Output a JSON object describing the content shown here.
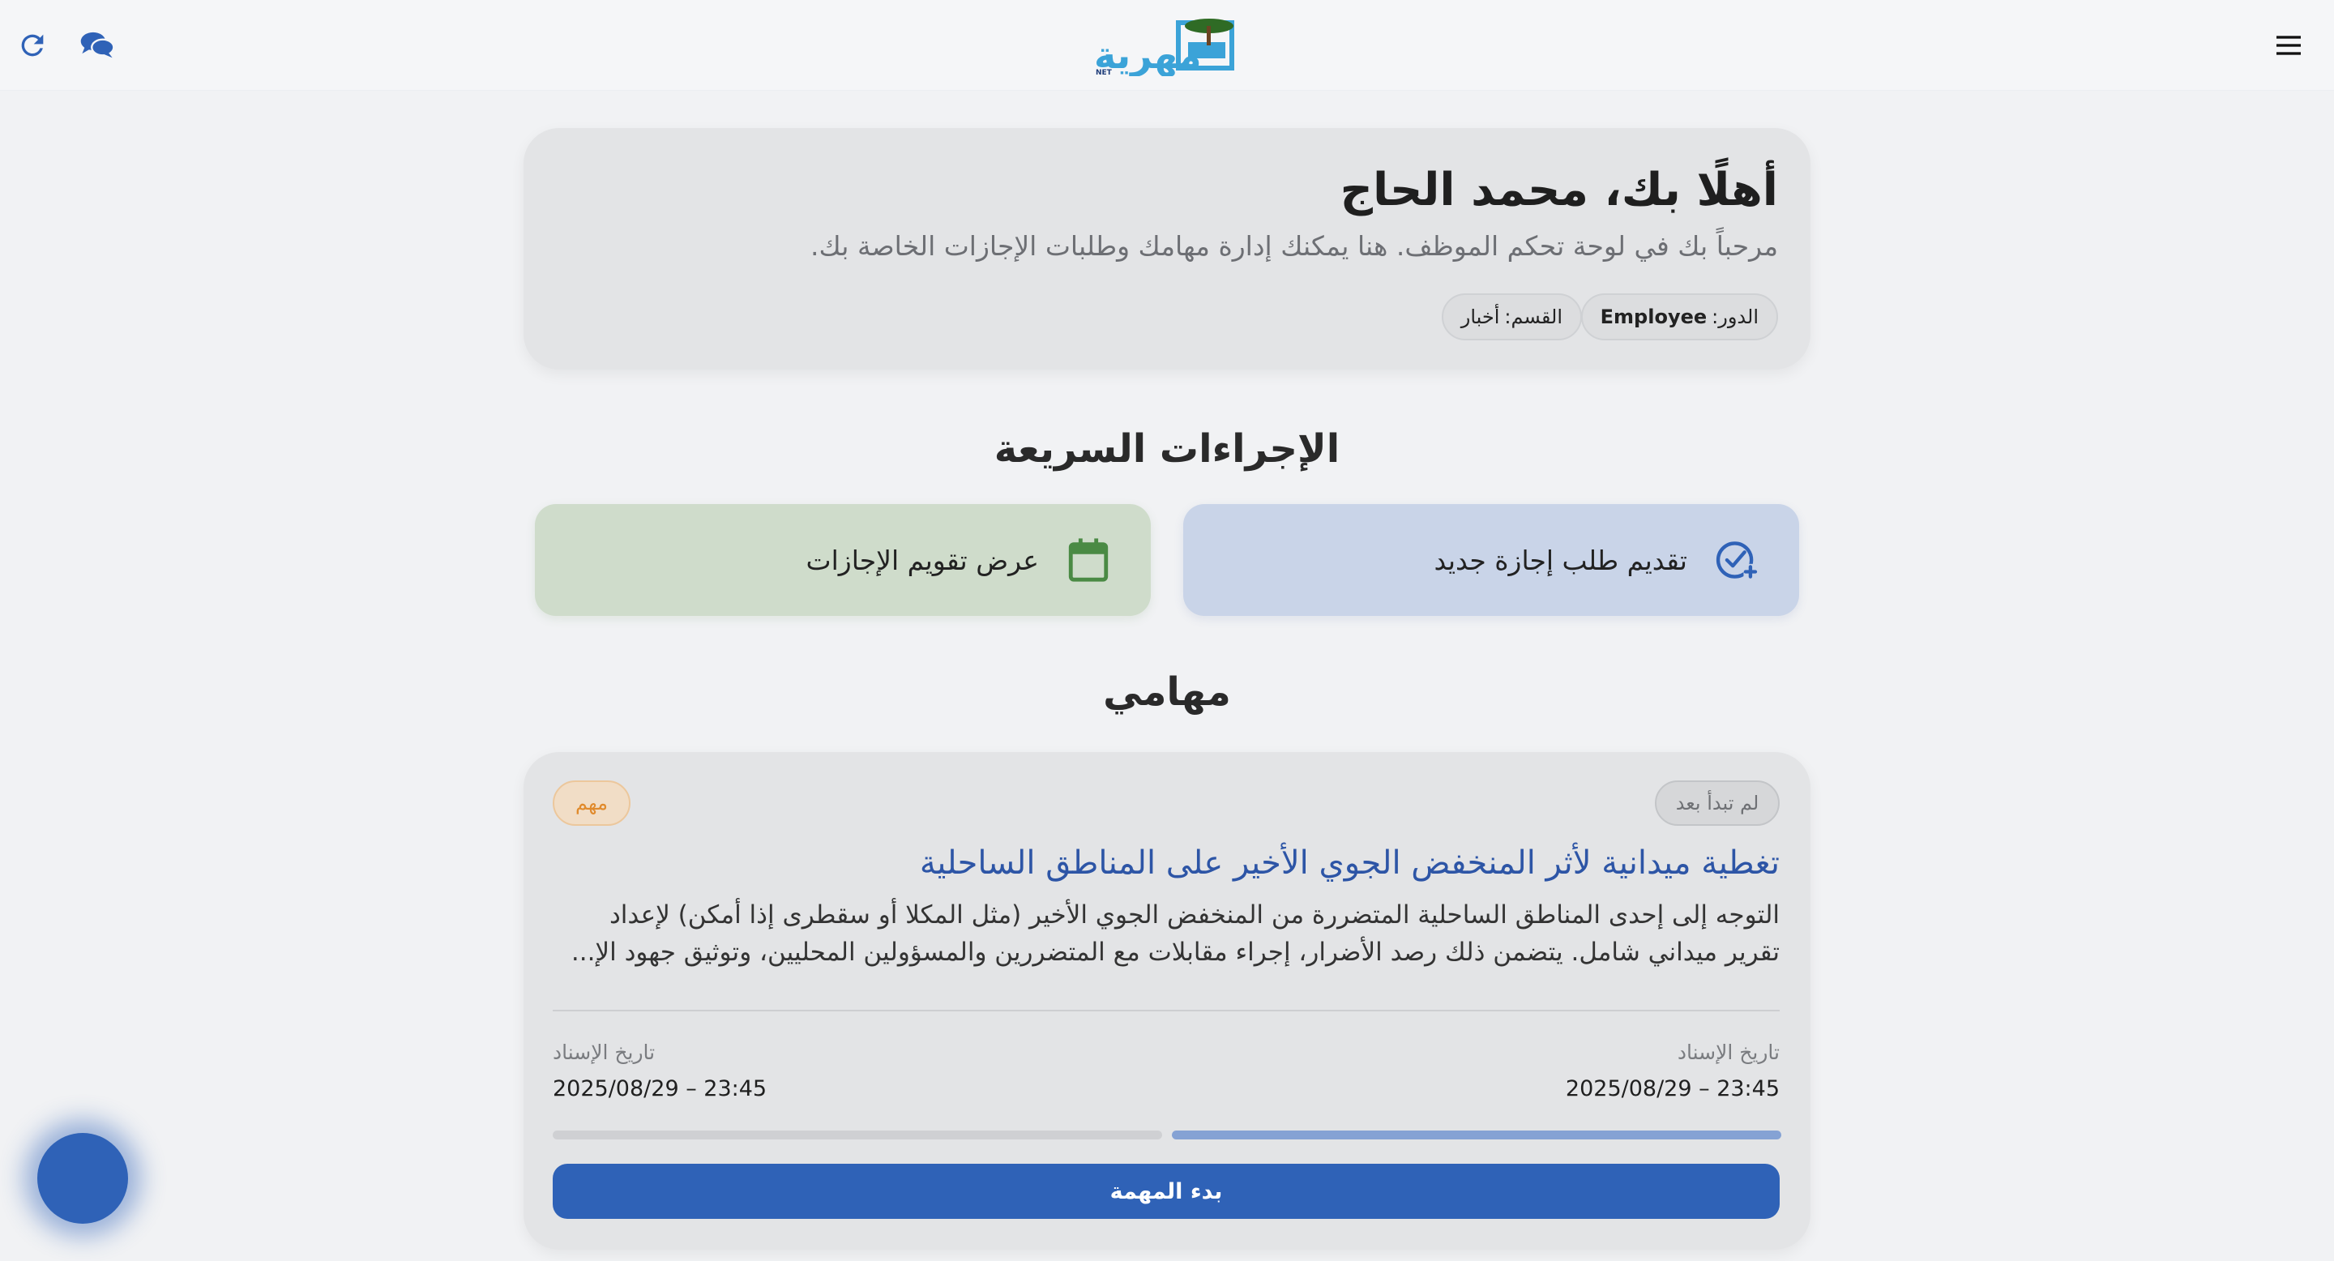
{
  "header": {
    "logo_alt": "المهرية NET",
    "icons": {
      "refresh": "refresh-icon",
      "chat": "chat-bubbles-icon",
      "menu": "hamburger-menu-icon"
    }
  },
  "welcome": {
    "title": "أهلًا بك، محمد الحاج",
    "subtitle": "مرحباً بك في لوحة تحكم الموظف. هنا يمكنك إدارة مهامك وطلبات الإجازات الخاصة بك.",
    "role_label": "الدور:",
    "role_value": "Employee",
    "dept_label": "القسم:",
    "dept_value": "أخبار"
  },
  "quick_actions": {
    "title": "الإجراءات السريعة",
    "new_leave": "تقديم طلب إجازة جديد",
    "calendar": "عرض تقويم الإجازات"
  },
  "tasks": {
    "title": "مهامي",
    "items": [
      {
        "status": "لم تبدأ بعد",
        "priority": "مهم",
        "title": "تغطية ميدانية لأثر المنخفض الجوي الأخير على المناطق الساحلية",
        "description": "التوجه إلى إحدى المناطق الساحلية المتضررة من المنخفض الجوي الأخير (مثل المكلا أو سقطرى إذا أمكن) لإعداد تقرير ميداني شامل. يتضمن ذلك رصد الأضرار، إجراء مقابلات مع المتضررين والمسؤولين المحليين، وتوثيق جهود الإ...",
        "assigned_label_right": "تاريخ الإسناد",
        "assigned_value_right": "2025/08/29 – 23:45",
        "assigned_label_left": "تاريخ الإسناد",
        "assigned_value_left": "2025/08/29 – 23:45",
        "start_button": "بدء المهمة"
      }
    ]
  },
  "colors": {
    "primary": "#2f62b7",
    "priority": "#e08a2c",
    "calendar_green": "#4a8a44"
  }
}
